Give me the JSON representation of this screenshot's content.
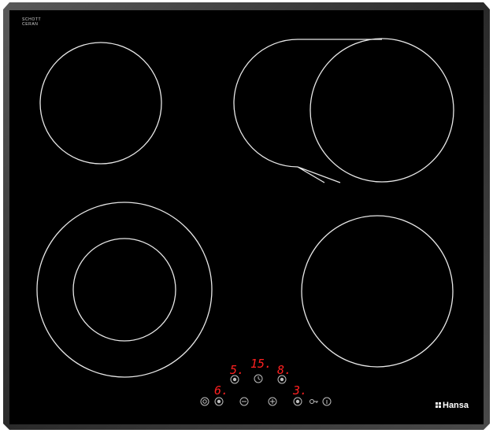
{
  "brand": {
    "logo_text": "Hansa",
    "manufacturer_mark": [
      "SCHOTT",
      "CERAN"
    ]
  },
  "colors": {
    "glass": "#000000",
    "frame": "#3a3a3a",
    "ring": "#e8e8e8",
    "display": "#ff2020"
  },
  "zones": [
    {
      "name": "rear-left",
      "type": "single"
    },
    {
      "name": "rear-right",
      "type": "extended-oval"
    },
    {
      "name": "front-left",
      "type": "dual-circuit"
    },
    {
      "name": "front-right",
      "type": "single"
    }
  ],
  "displays": {
    "rear_left_power": "5.",
    "timer": "15.",
    "rear_right_power": "8.",
    "front_left_power": "6.",
    "front_right_power": "3."
  },
  "controls": {
    "icons": [
      "power-icon",
      "zone-select-icon",
      "minus-icon",
      "plus-icon",
      "timer-icon",
      "key-lock-icon",
      "info-icon"
    ]
  }
}
